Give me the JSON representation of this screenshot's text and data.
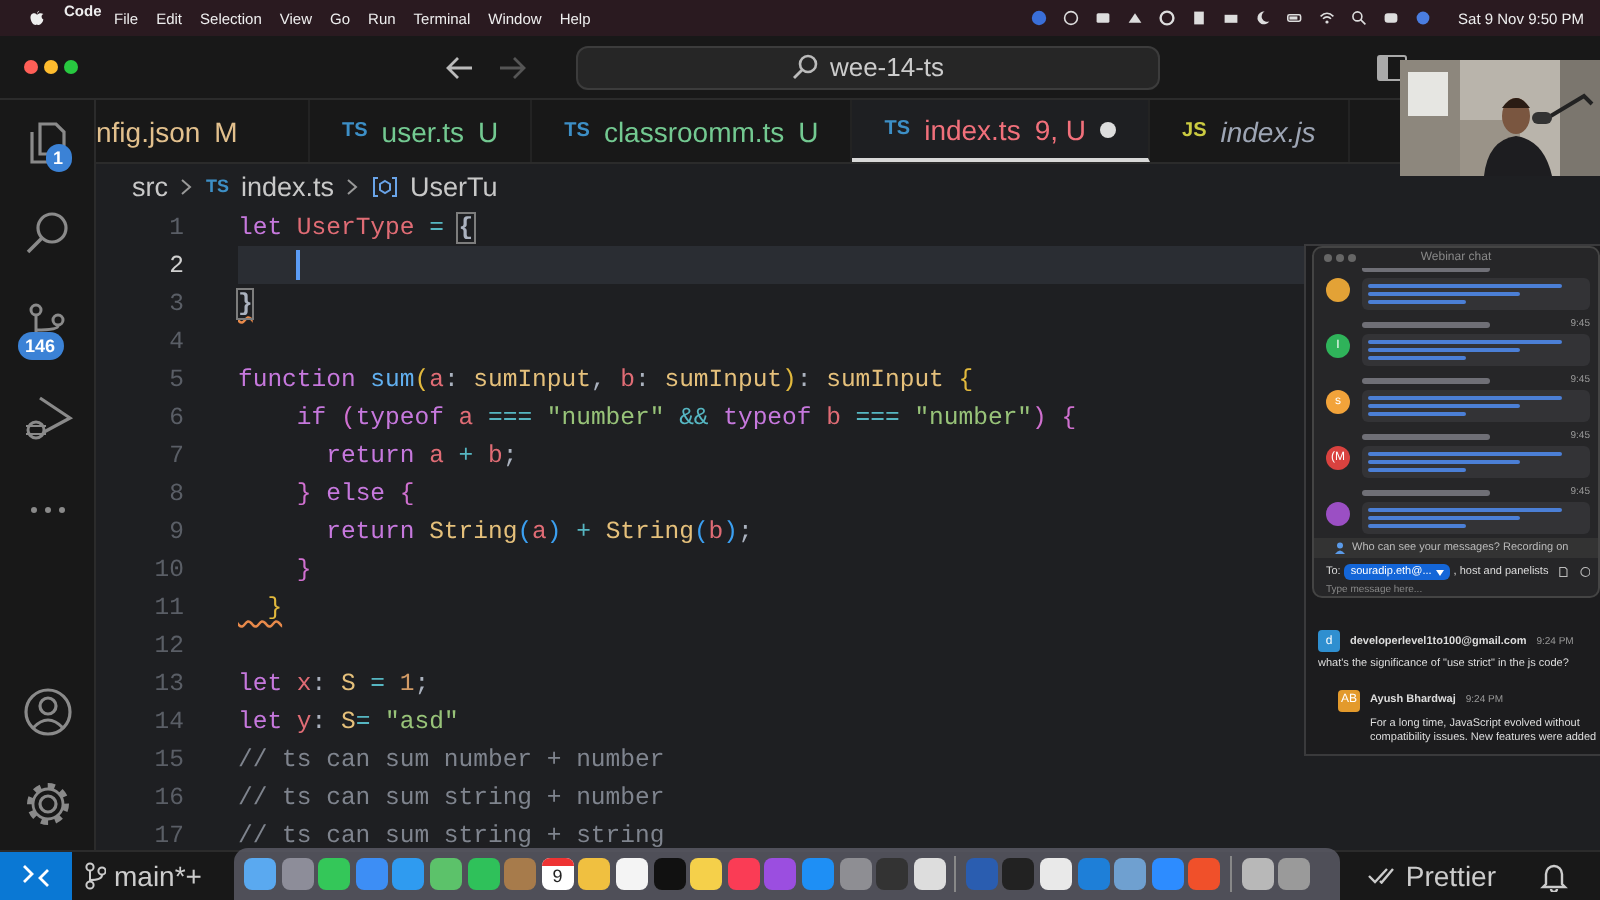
{
  "menu_bar": {
    "app": "Code",
    "items": [
      "File",
      "Edit",
      "Selection",
      "View",
      "Go",
      "Run",
      "Terminal",
      "Window",
      "Help"
    ],
    "clock": "Sat 9 Nov 9:50 PM"
  },
  "title_bar": {
    "search": "wee-14-ts"
  },
  "activity_bar": {
    "explorer_badge": "1",
    "source_control_badge": "146"
  },
  "tabs": [
    {
      "label": "nfig.json",
      "status": "M",
      "kind": "modified",
      "selected": false,
      "dirty": false,
      "preview": false
    },
    {
      "icon": "TS",
      "label": "user.ts",
      "status": "U",
      "kind": "untracked",
      "selected": false,
      "dirty": false,
      "preview": false
    },
    {
      "icon": "TS",
      "label": "classroomm.ts",
      "status": "U",
      "kind": "untracked",
      "selected": false,
      "dirty": false,
      "preview": false
    },
    {
      "icon": "TS",
      "label": "index.ts",
      "status": "9, U",
      "kind": "error",
      "selected": true,
      "dirty": true,
      "preview": false
    },
    {
      "icon": "JS",
      "label": "index.js",
      "kind": "plain",
      "selected": false,
      "dirty": false,
      "preview": true
    }
  ],
  "breadcrumb": {
    "folder": "src",
    "file_icon": "TS",
    "file": "index.ts",
    "symbol": "UserTu"
  },
  "code_lines": [
    {
      "number": "1",
      "current": false,
      "tokens": [
        {
          "t": "let",
          "color": "#c678dd",
          "kind": "plain"
        },
        {
          "t": " UserType",
          "color": "#e06c75",
          "kind": "plain"
        },
        {
          "t": " = ",
          "color": "#56b6c2",
          "kind": "plain"
        },
        {
          "t": "{",
          "color": "#abb2bf",
          "kind": "bracket"
        }
      ]
    },
    {
      "number": "2",
      "current": true
    },
    {
      "number": "3",
      "current": false,
      "tokens": [
        {
          "t": "}",
          "color": "#abb2bf",
          "kind": "bracket-error"
        }
      ]
    },
    {
      "number": "4",
      "current": false
    },
    {
      "number": "5",
      "current": false,
      "tokens": [
        {
          "t": "function",
          "color": "#c678dd",
          "kind": "plain"
        },
        {
          "t": " sum",
          "color": "#61afef",
          "kind": "plain"
        },
        {
          "t": "(",
          "color": "#e2b93d",
          "kind": "plain"
        },
        {
          "t": "a",
          "color": "#e06c75",
          "kind": "plain"
        },
        {
          "t": ": ",
          "color": "#abb2bf",
          "kind": "plain"
        },
        {
          "t": "sumInput",
          "color": "#e5c07b",
          "kind": "plain"
        },
        {
          "t": ", ",
          "color": "#abb2bf",
          "kind": "plain"
        },
        {
          "t": "b",
          "color": "#e06c75",
          "kind": "plain"
        },
        {
          "t": ": ",
          "color": "#abb2bf",
          "kind": "plain"
        },
        {
          "t": "sumInput",
          "color": "#e5c07b",
          "kind": "plain"
        },
        {
          "t": ")",
          "color": "#e2b93d",
          "kind": "plain"
        },
        {
          "t": ": ",
          "color": "#abb2bf",
          "kind": "plain"
        },
        {
          "t": "sumInput",
          "color": "#e5c07b",
          "kind": "plain"
        },
        {
          "t": " {",
          "color": "#e2b93d",
          "kind": "plain"
        }
      ]
    },
    {
      "number": "6",
      "current": false,
      "tokens": [
        {
          "t": "    if ",
          "color": "#c678dd",
          "kind": "plain"
        },
        {
          "t": "(",
          "color": "#d070d0",
          "kind": "plain"
        },
        {
          "t": "typeof",
          "color": "#c678dd",
          "kind": "plain"
        },
        {
          "t": " a",
          "color": "#e06c75",
          "kind": "plain"
        },
        {
          "t": " ===",
          "color": "#56b6c2",
          "kind": "plain"
        },
        {
          "t": " \"number\"",
          "color": "#98c379",
          "kind": "plain"
        },
        {
          "t": " &&",
          "color": "#56b6c2",
          "kind": "plain"
        },
        {
          "t": " typeof",
          "color": "#c678dd",
          "kind": "plain"
        },
        {
          "t": " b",
          "color": "#e06c75",
          "kind": "plain"
        },
        {
          "t": " ===",
          "color": "#56b6c2",
          "kind": "plain"
        },
        {
          "t": " \"number\"",
          "color": "#98c379",
          "kind": "plain"
        },
        {
          "t": ")",
          "color": "#d070d0",
          "kind": "plain"
        },
        {
          "t": " {",
          "color": "#d070d0",
          "kind": "plain"
        }
      ]
    },
    {
      "number": "7",
      "current": false,
      "tokens": [
        {
          "t": "      return",
          "color": "#c678dd",
          "kind": "plain"
        },
        {
          "t": " a",
          "color": "#e06c75",
          "kind": "plain"
        },
        {
          "t": " +",
          "color": "#56b6c2",
          "kind": "plain"
        },
        {
          "t": " b",
          "color": "#e06c75",
          "kind": "plain"
        },
        {
          "t": ";",
          "color": "#abb2bf",
          "kind": "plain"
        }
      ]
    },
    {
      "number": "8",
      "current": false,
      "tokens": [
        {
          "t": "    }",
          "color": "#d070d0",
          "kind": "plain"
        },
        {
          "t": " else ",
          "color": "#c678dd",
          "kind": "plain"
        },
        {
          "t": "{",
          "color": "#d070d0",
          "kind": "plain"
        }
      ]
    },
    {
      "number": "9",
      "current": false,
      "tokens": [
        {
          "t": "      return",
          "color": "#c678dd",
          "kind": "plain"
        },
        {
          "t": " String",
          "color": "#e5c07b",
          "kind": "plain"
        },
        {
          "t": "(",
          "color": "#3b9ff0",
          "kind": "plain"
        },
        {
          "t": "a",
          "color": "#e06c75",
          "kind": "plain"
        },
        {
          "t": ")",
          "color": "#3b9ff0",
          "kind": "plain"
        },
        {
          "t": " +",
          "color": "#56b6c2",
          "kind": "plain"
        },
        {
          "t": " String",
          "color": "#e5c07b",
          "kind": "plain"
        },
        {
          "t": "(",
          "color": "#3b9ff0",
          "kind": "plain"
        },
        {
          "t": "b",
          "color": "#e06c75",
          "kind": "plain"
        },
        {
          "t": ")",
          "color": "#3b9ff0",
          "kind": "plain"
        },
        {
          "t": ";",
          "color": "#abb2bf",
          "kind": "plain"
        }
      ]
    },
    {
      "number": "10",
      "current": false,
      "tokens": [
        {
          "t": "    }",
          "color": "#d070d0",
          "kind": "plain"
        }
      ]
    },
    {
      "number": "11",
      "current": false,
      "tokens": [
        {
          "t": "  }",
          "color": "#e2b93d",
          "kind": "error"
        }
      ]
    },
    {
      "number": "12",
      "current": false
    },
    {
      "number": "13",
      "current": false,
      "tokens": [
        {
          "t": "let",
          "color": "#c678dd",
          "kind": "plain"
        },
        {
          "t": " x",
          "color": "#e06c75",
          "kind": "plain"
        },
        {
          "t": ": ",
          "color": "#abb2bf",
          "kind": "plain"
        },
        {
          "t": "S",
          "color": "#e5c07b",
          "kind": "plain"
        },
        {
          "t": " =",
          "color": "#56b6c2",
          "kind": "plain"
        },
        {
          "t": " 1",
          "color": "#d19a66",
          "kind": "plain"
        },
        {
          "t": ";",
          "color": "#abb2bf",
          "kind": "plain"
        }
      ]
    },
    {
      "number": "14",
      "current": false,
      "tokens": [
        {
          "t": "let",
          "color": "#c678dd",
          "kind": "plain"
        },
        {
          "t": " y",
          "color": "#e06c75",
          "kind": "plain"
        },
        {
          "t": ": ",
          "color": "#abb2bf",
          "kind": "plain"
        },
        {
          "t": "S",
          "color": "#e5c07b",
          "kind": "plain"
        },
        {
          "t": "=",
          "color": "#56b6c2",
          "kind": "plain"
        },
        {
          "t": " \"asd\"",
          "color": "#98c379",
          "kind": "plain"
        }
      ]
    },
    {
      "number": "15",
      "current": false,
      "tokens": [
        {
          "t": "// ts can sum number + number",
          "color": "#7f848e",
          "kind": "plain"
        }
      ]
    },
    {
      "number": "16",
      "current": false,
      "tokens": [
        {
          "t": "// ts can sum string + number",
          "color": "#7f848e",
          "kind": "plain"
        }
      ]
    },
    {
      "number": "17",
      "current": false,
      "tokens": [
        {
          "t": "// ts can sum string + string",
          "color": "#7f848e",
          "kind": "plain"
        }
      ]
    }
  ],
  "status_bar": {
    "branch": "main*+",
    "formatter": "Prettier"
  },
  "dock": {
    "calendar_day": "9"
  },
  "webinar_chat": {
    "title": "Webinar chat",
    "messages": [
      {
        "color": "#e3a236"
      },
      {
        "avatar": "I",
        "color": "#2fb35a",
        "time": "9:45"
      },
      {
        "avatar": "s",
        "color": "#f2a33a",
        "time": "9:45"
      },
      {
        "avatar": "(M",
        "color": "#d9423f",
        "time": "9:45"
      },
      {
        "color": "#9b4fc4",
        "time": "9:45"
      }
    ],
    "visibility_notice": "Who can see your messages? Recording on",
    "to_label": "To:",
    "recipient": "souradip.eth@...",
    "recipient_rest": ", host and panelists",
    "placeholder": "Type message here...",
    "questions": [
      {
        "avatar": "d",
        "color": "#2f8fd0",
        "author": "developerlevel1to100@gmail.com",
        "time": "9:24 PM",
        "text": "what's the significance of \"use strict\" in the js code?"
      },
      {
        "avatar": "AB",
        "color": "#e39a2c",
        "author": "Ayush Bhardwaj",
        "time": "9:24 PM",
        "text": "For a long time, JavaScript evolved without\ncompatibility issues. New features were added"
      }
    ]
  }
}
